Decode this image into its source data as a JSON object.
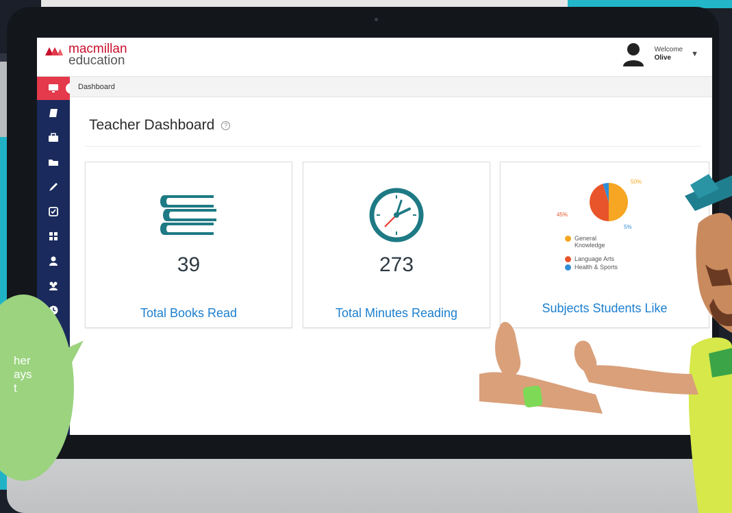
{
  "brand": {
    "line1": "macmillan",
    "line2": "education",
    "accent_color": "#c8102e"
  },
  "header": {
    "welcome_label": "Welcome",
    "user_name": "Olive"
  },
  "breadcrumb": "Dashboard",
  "page_title": "Teacher Dashboard",
  "help_glyph": "?",
  "sidebar": {
    "items": [
      {
        "icon": "monitor-icon",
        "active": true
      },
      {
        "icon": "book-icon"
      },
      {
        "icon": "briefcase-icon"
      },
      {
        "icon": "folder-icon"
      },
      {
        "icon": "pencil-icon"
      },
      {
        "icon": "checkbox-icon"
      },
      {
        "icon": "grid-icon"
      },
      {
        "icon": "user-icon"
      },
      {
        "icon": "users-icon"
      },
      {
        "icon": "clock-icon"
      }
    ],
    "bg_color": "#1a2a5c",
    "active_color": "#e43a4c"
  },
  "cards": [
    {
      "value": "39",
      "label": "Total Books Read",
      "icon": "books-icon"
    },
    {
      "value": "273",
      "label": "Total Minutes Reading",
      "icon": "clock-icon"
    },
    {
      "label": "Subjects Students Like",
      "icon": "pie-chart-icon"
    }
  ],
  "chart_data": {
    "type": "pie",
    "slices": [
      {
        "name": "General Knowledge",
        "value": 50,
        "color": "#f6a623"
      },
      {
        "name": "Language Arts",
        "value": 45,
        "color": "#e8552a"
      },
      {
        "name": "Health & Sports",
        "value": 5,
        "color": "#2f8ed8"
      }
    ],
    "labels": {
      "general": "50%",
      "language": "45%",
      "health": "5%"
    },
    "legend": [
      {
        "text": "General Knowledge",
        "color": "#f6a623"
      },
      {
        "text": "Language Arts",
        "color": "#e8552a"
      },
      {
        "text": "Health & Sports",
        "color": "#2f8ed8"
      }
    ]
  },
  "bubble_lines": [
    "her",
    "ays",
    "t"
  ]
}
